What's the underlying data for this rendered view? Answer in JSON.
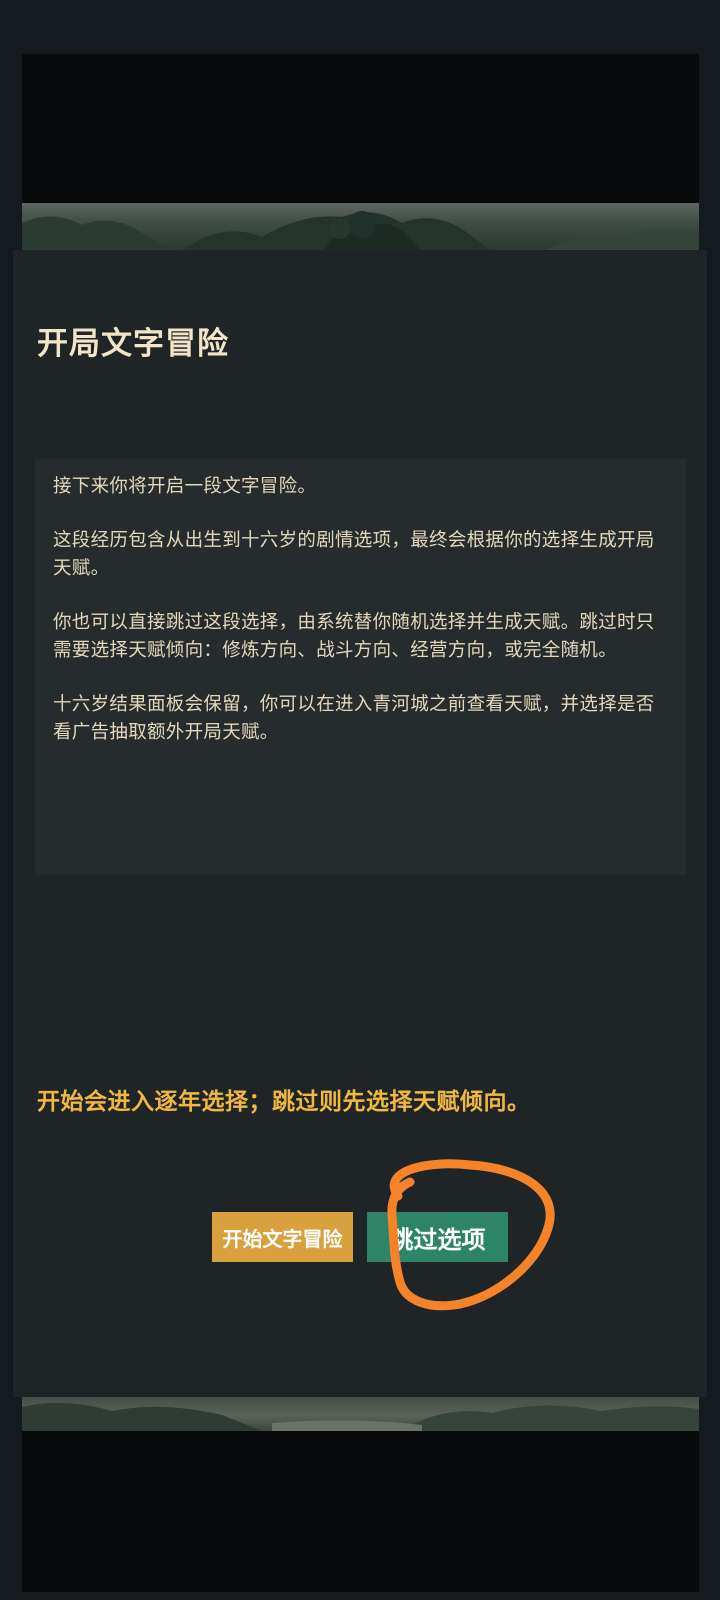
{
  "dialog": {
    "title": "开局文字冒险",
    "message": [
      "接下来你将开启一段文字冒险。",
      "这段经历包含从出生到十六岁的剧情选项，最终会根据你的选择生成开局天赋。",
      "你也可以直接跳过这段选择，由系统替你随机选择并生成天赋。跳过时只需要选择天赋倾向：修炼方向、战斗方向、经营方向，或完全随机。",
      "十六岁结果面板会保留，你可以在进入青河城之前查看天赋，并选择是否看广告抽取额外开局天赋。"
    ],
    "hint": "开始会进入逐年选择；跳过则先选择天赋倾向。",
    "buttons": {
      "start": "开始文字冒险",
      "skip": "跳过选项"
    }
  },
  "colors": {
    "title": "#f1e4c8",
    "hint": "#f0b840",
    "start_button": "#d8a13e",
    "skip_button": "#2d8467",
    "annotation": "#f5832a"
  },
  "annotation": {
    "icon": "hand-drawn-circle-icon"
  }
}
